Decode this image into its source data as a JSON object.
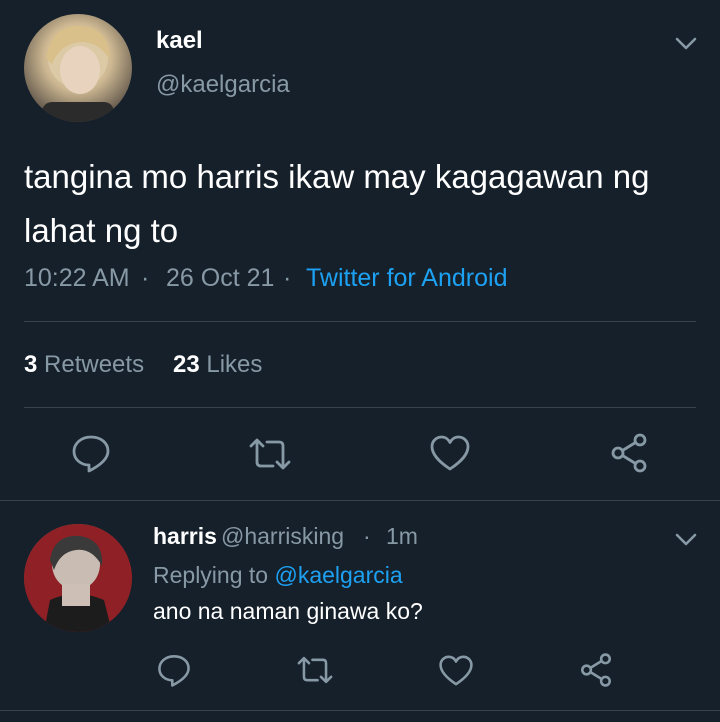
{
  "tweet": {
    "display_name": "kael",
    "handle": "@kaelgarcia",
    "text": "tangina mo harris ikaw may kagagawan ng lahat ng to",
    "time": "10:22 AM",
    "date": "26 Oct 21",
    "separator": "·",
    "source": "Twitter for Android",
    "retweets_count": "3",
    "retweets_label": "Retweets",
    "likes_count": "23",
    "likes_label": "Likes"
  },
  "reply": {
    "display_name": "harris",
    "handle": "@harrisking",
    "separator": "·",
    "time": "1m",
    "replying_prefix": "Replying to",
    "replying_to": "@kaelgarcia",
    "text": "ano na naman ginawa ko?"
  },
  "colors": {
    "background": "#15202b",
    "text_primary": "#ffffff",
    "text_secondary": "#8899a6",
    "accent": "#1da1f2",
    "divider": "#38444d"
  },
  "icons": {
    "actions": [
      "reply-icon",
      "retweet-icon",
      "like-icon",
      "share-icon"
    ],
    "menu": "chevron-down-icon"
  }
}
